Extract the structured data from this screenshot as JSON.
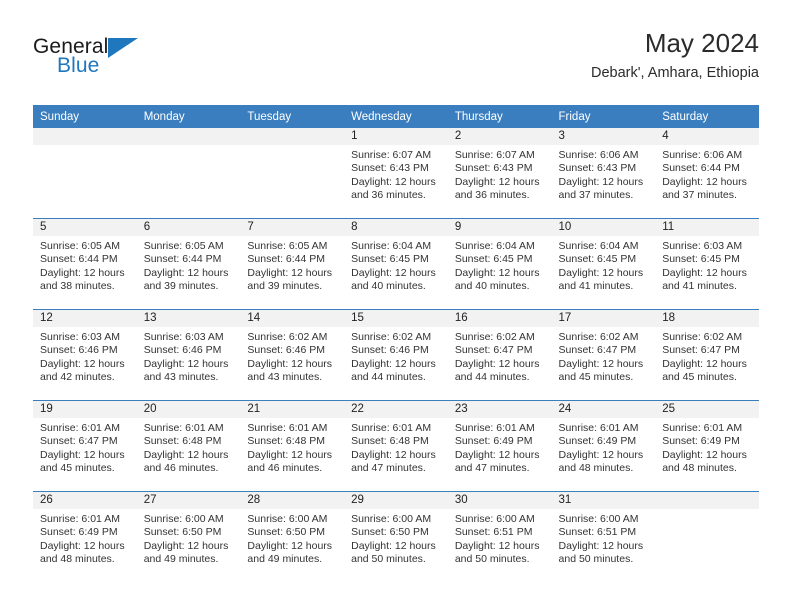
{
  "brand": {
    "name_part1": "General",
    "name_part2": "Blue",
    "logo_icon": "triangle-flag-icon"
  },
  "header": {
    "title": "May 2024",
    "location": "Debark', Amhara, Ethiopia"
  },
  "colors": {
    "header_blue": "#3a7ebf",
    "date_strip_gray": "#f2f2f2",
    "brand_blue": "#1f77bd",
    "text": "#333333"
  },
  "weekdays": [
    "Sunday",
    "Monday",
    "Tuesday",
    "Wednesday",
    "Thursday",
    "Friday",
    "Saturday"
  ],
  "weeks": [
    [
      {
        "date": "",
        "sunrise": "",
        "sunset": "",
        "daylight_line1": "",
        "daylight_line2": ""
      },
      {
        "date": "",
        "sunrise": "",
        "sunset": "",
        "daylight_line1": "",
        "daylight_line2": ""
      },
      {
        "date": "",
        "sunrise": "",
        "sunset": "",
        "daylight_line1": "",
        "daylight_line2": ""
      },
      {
        "date": "1",
        "sunrise": "Sunrise: 6:07 AM",
        "sunset": "Sunset: 6:43 PM",
        "daylight_line1": "Daylight: 12 hours",
        "daylight_line2": "and 36 minutes."
      },
      {
        "date": "2",
        "sunrise": "Sunrise: 6:07 AM",
        "sunset": "Sunset: 6:43 PM",
        "daylight_line1": "Daylight: 12 hours",
        "daylight_line2": "and 36 minutes."
      },
      {
        "date": "3",
        "sunrise": "Sunrise: 6:06 AM",
        "sunset": "Sunset: 6:43 PM",
        "daylight_line1": "Daylight: 12 hours",
        "daylight_line2": "and 37 minutes."
      },
      {
        "date": "4",
        "sunrise": "Sunrise: 6:06 AM",
        "sunset": "Sunset: 6:44 PM",
        "daylight_line1": "Daylight: 12 hours",
        "daylight_line2": "and 37 minutes."
      }
    ],
    [
      {
        "date": "5",
        "sunrise": "Sunrise: 6:05 AM",
        "sunset": "Sunset: 6:44 PM",
        "daylight_line1": "Daylight: 12 hours",
        "daylight_line2": "and 38 minutes."
      },
      {
        "date": "6",
        "sunrise": "Sunrise: 6:05 AM",
        "sunset": "Sunset: 6:44 PM",
        "daylight_line1": "Daylight: 12 hours",
        "daylight_line2": "and 39 minutes."
      },
      {
        "date": "7",
        "sunrise": "Sunrise: 6:05 AM",
        "sunset": "Sunset: 6:44 PM",
        "daylight_line1": "Daylight: 12 hours",
        "daylight_line2": "and 39 minutes."
      },
      {
        "date": "8",
        "sunrise": "Sunrise: 6:04 AM",
        "sunset": "Sunset: 6:45 PM",
        "daylight_line1": "Daylight: 12 hours",
        "daylight_line2": "and 40 minutes."
      },
      {
        "date": "9",
        "sunrise": "Sunrise: 6:04 AM",
        "sunset": "Sunset: 6:45 PM",
        "daylight_line1": "Daylight: 12 hours",
        "daylight_line2": "and 40 minutes."
      },
      {
        "date": "10",
        "sunrise": "Sunrise: 6:04 AM",
        "sunset": "Sunset: 6:45 PM",
        "daylight_line1": "Daylight: 12 hours",
        "daylight_line2": "and 41 minutes."
      },
      {
        "date": "11",
        "sunrise": "Sunrise: 6:03 AM",
        "sunset": "Sunset: 6:45 PM",
        "daylight_line1": "Daylight: 12 hours",
        "daylight_line2": "and 41 minutes."
      }
    ],
    [
      {
        "date": "12",
        "sunrise": "Sunrise: 6:03 AM",
        "sunset": "Sunset: 6:46 PM",
        "daylight_line1": "Daylight: 12 hours",
        "daylight_line2": "and 42 minutes."
      },
      {
        "date": "13",
        "sunrise": "Sunrise: 6:03 AM",
        "sunset": "Sunset: 6:46 PM",
        "daylight_line1": "Daylight: 12 hours",
        "daylight_line2": "and 43 minutes."
      },
      {
        "date": "14",
        "sunrise": "Sunrise: 6:02 AM",
        "sunset": "Sunset: 6:46 PM",
        "daylight_line1": "Daylight: 12 hours",
        "daylight_line2": "and 43 minutes."
      },
      {
        "date": "15",
        "sunrise": "Sunrise: 6:02 AM",
        "sunset": "Sunset: 6:46 PM",
        "daylight_line1": "Daylight: 12 hours",
        "daylight_line2": "and 44 minutes."
      },
      {
        "date": "16",
        "sunrise": "Sunrise: 6:02 AM",
        "sunset": "Sunset: 6:47 PM",
        "daylight_line1": "Daylight: 12 hours",
        "daylight_line2": "and 44 minutes."
      },
      {
        "date": "17",
        "sunrise": "Sunrise: 6:02 AM",
        "sunset": "Sunset: 6:47 PM",
        "daylight_line1": "Daylight: 12 hours",
        "daylight_line2": "and 45 minutes."
      },
      {
        "date": "18",
        "sunrise": "Sunrise: 6:02 AM",
        "sunset": "Sunset: 6:47 PM",
        "daylight_line1": "Daylight: 12 hours",
        "daylight_line2": "and 45 minutes."
      }
    ],
    [
      {
        "date": "19",
        "sunrise": "Sunrise: 6:01 AM",
        "sunset": "Sunset: 6:47 PM",
        "daylight_line1": "Daylight: 12 hours",
        "daylight_line2": "and 45 minutes."
      },
      {
        "date": "20",
        "sunrise": "Sunrise: 6:01 AM",
        "sunset": "Sunset: 6:48 PM",
        "daylight_line1": "Daylight: 12 hours",
        "daylight_line2": "and 46 minutes."
      },
      {
        "date": "21",
        "sunrise": "Sunrise: 6:01 AM",
        "sunset": "Sunset: 6:48 PM",
        "daylight_line1": "Daylight: 12 hours",
        "daylight_line2": "and 46 minutes."
      },
      {
        "date": "22",
        "sunrise": "Sunrise: 6:01 AM",
        "sunset": "Sunset: 6:48 PM",
        "daylight_line1": "Daylight: 12 hours",
        "daylight_line2": "and 47 minutes."
      },
      {
        "date": "23",
        "sunrise": "Sunrise: 6:01 AM",
        "sunset": "Sunset: 6:49 PM",
        "daylight_line1": "Daylight: 12 hours",
        "daylight_line2": "and 47 minutes."
      },
      {
        "date": "24",
        "sunrise": "Sunrise: 6:01 AM",
        "sunset": "Sunset: 6:49 PM",
        "daylight_line1": "Daylight: 12 hours",
        "daylight_line2": "and 48 minutes."
      },
      {
        "date": "25",
        "sunrise": "Sunrise: 6:01 AM",
        "sunset": "Sunset: 6:49 PM",
        "daylight_line1": "Daylight: 12 hours",
        "daylight_line2": "and 48 minutes."
      }
    ],
    [
      {
        "date": "26",
        "sunrise": "Sunrise: 6:01 AM",
        "sunset": "Sunset: 6:49 PM",
        "daylight_line1": "Daylight: 12 hours",
        "daylight_line2": "and 48 minutes."
      },
      {
        "date": "27",
        "sunrise": "Sunrise: 6:00 AM",
        "sunset": "Sunset: 6:50 PM",
        "daylight_line1": "Daylight: 12 hours",
        "daylight_line2": "and 49 minutes."
      },
      {
        "date": "28",
        "sunrise": "Sunrise: 6:00 AM",
        "sunset": "Sunset: 6:50 PM",
        "daylight_line1": "Daylight: 12 hours",
        "daylight_line2": "and 49 minutes."
      },
      {
        "date": "29",
        "sunrise": "Sunrise: 6:00 AM",
        "sunset": "Sunset: 6:50 PM",
        "daylight_line1": "Daylight: 12 hours",
        "daylight_line2": "and 50 minutes."
      },
      {
        "date": "30",
        "sunrise": "Sunrise: 6:00 AM",
        "sunset": "Sunset: 6:51 PM",
        "daylight_line1": "Daylight: 12 hours",
        "daylight_line2": "and 50 minutes."
      },
      {
        "date": "31",
        "sunrise": "Sunrise: 6:00 AM",
        "sunset": "Sunset: 6:51 PM",
        "daylight_line1": "Daylight: 12 hours",
        "daylight_line2": "and 50 minutes."
      },
      {
        "date": "",
        "sunrise": "",
        "sunset": "",
        "daylight_line1": "",
        "daylight_line2": ""
      }
    ]
  ]
}
